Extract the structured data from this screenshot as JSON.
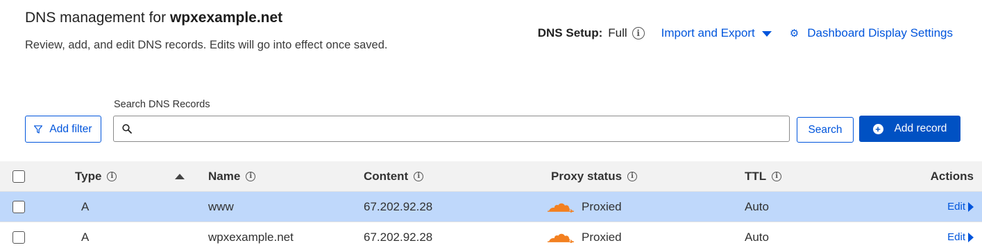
{
  "header": {
    "title_prefix": "DNS management for ",
    "domain": "wpxexample.net",
    "description": "Review, add, and edit DNS records. Edits will go into effect once saved."
  },
  "dns_setup": {
    "label": "DNS Setup:",
    "value": "Full"
  },
  "links": {
    "import_export": "Import and Export",
    "dashboard_settings": "Dashboard Display Settings"
  },
  "toolbar": {
    "add_filter": "Add filter",
    "search_label": "Search DNS Records",
    "search_value": "",
    "search_button": "Search",
    "add_record": "Add record"
  },
  "table": {
    "columns": {
      "type": "Type",
      "name": "Name",
      "content": "Content",
      "proxy_status": "Proxy status",
      "ttl": "TTL",
      "actions": "Actions"
    },
    "rows": [
      {
        "type": "A",
        "name": "www",
        "content": "67.202.92.28",
        "proxy": "Proxied",
        "ttl": "Auto",
        "action": "Edit",
        "selected": true
      },
      {
        "type": "A",
        "name": "wpxexample.net",
        "content": "67.202.92.28",
        "proxy": "Proxied",
        "ttl": "Auto",
        "action": "Edit",
        "selected": false
      }
    ]
  },
  "colors": {
    "accent": "#0055dc",
    "primary_button": "#0051c3",
    "selected_row": "#bfd8fb",
    "cloud": "#f38020"
  }
}
